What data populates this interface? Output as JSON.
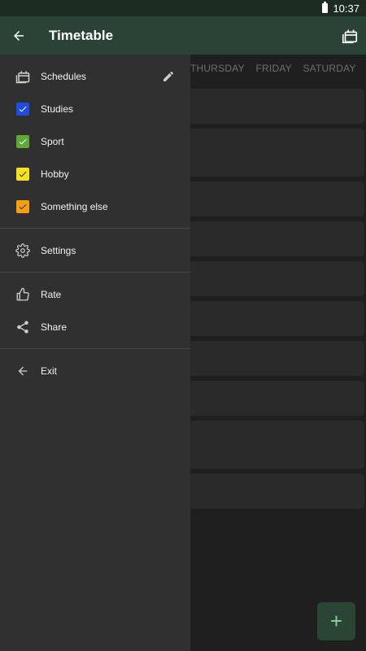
{
  "status": {
    "time": "10:37"
  },
  "appbar": {
    "title": "Timetable"
  },
  "days": [
    "THURSDAY",
    "FRIDAY",
    "SATURDAY"
  ],
  "fab": {
    "label": "+"
  },
  "drawer": {
    "schedules_label": "Schedules",
    "categories": [
      {
        "label": "Studies",
        "color": "#1e4de0"
      },
      {
        "label": "Sport",
        "color": "#5ea83a"
      },
      {
        "label": "Hobby",
        "color": "#f4e21e"
      },
      {
        "label": "Something else",
        "color": "#f5a012"
      }
    ],
    "settings_label": "Settings",
    "rate_label": "Rate",
    "share_label": "Share",
    "exit_label": "Exit"
  }
}
